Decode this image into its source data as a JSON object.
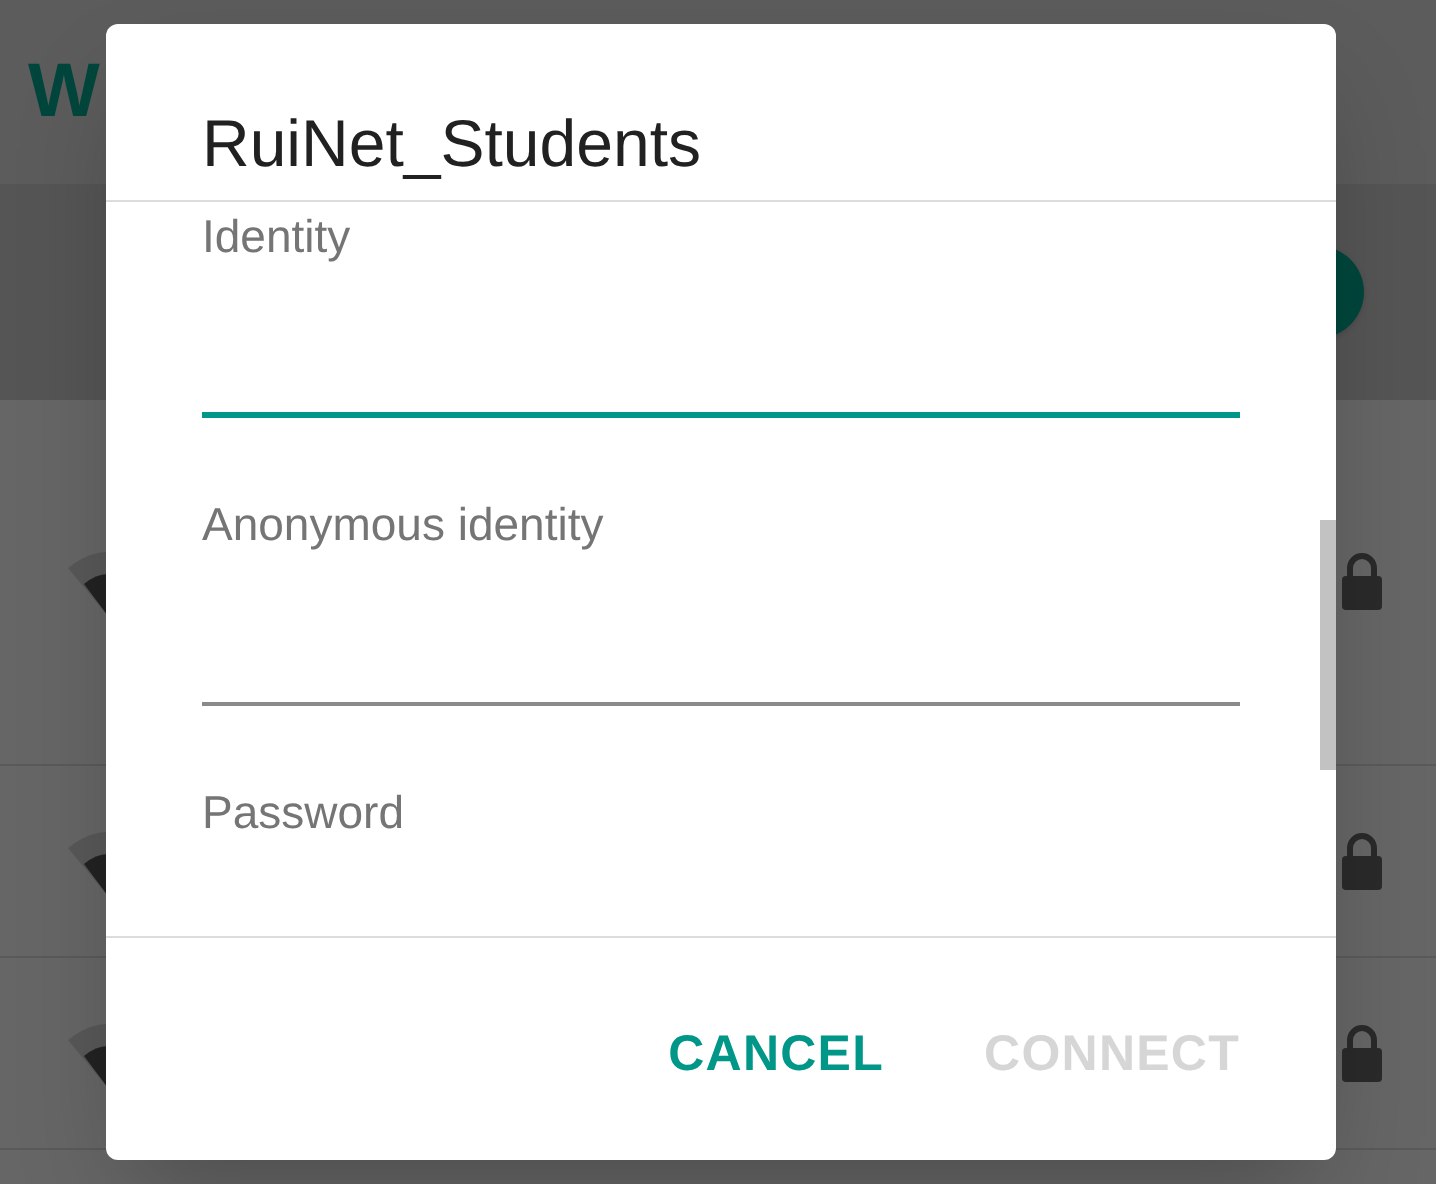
{
  "background": {
    "title": "W",
    "switch": {
      "on": true
    },
    "networks": [
      {
        "secured": true
      },
      {
        "secured": true
      },
      {
        "secured": true
      }
    ]
  },
  "dialog": {
    "title": "RuiNet_Students",
    "fields": [
      {
        "kind": "text_field",
        "label": "Identity",
        "focused": true
      },
      {
        "kind": "text_field",
        "label": "Anonymous identity",
        "focused": false
      },
      {
        "kind": "label_only",
        "label": "Password"
      }
    ],
    "buttons": [
      {
        "label": "CANCEL",
        "disabled": false
      },
      {
        "label": "CONNECT",
        "disabled": true
      }
    ]
  }
}
